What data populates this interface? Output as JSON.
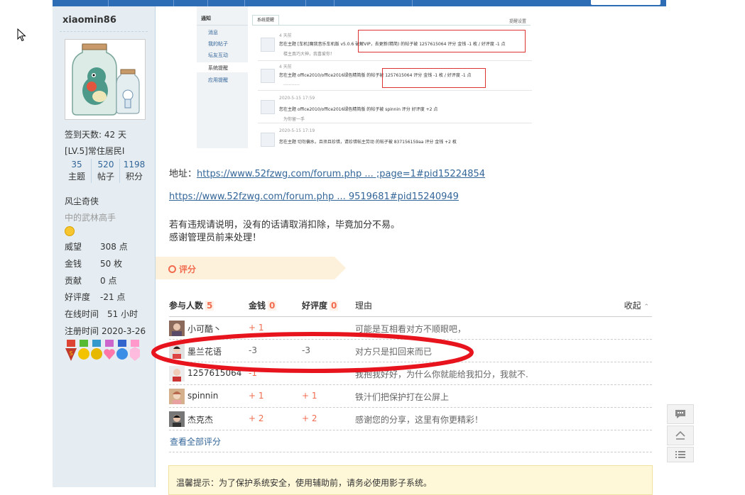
{
  "user": {
    "name": "xiaomin86",
    "checkin": "签到天数: 42 天",
    "level": "[LV.5]常住居民I",
    "stats": [
      {
        "num": "35",
        "label": "主题"
      },
      {
        "num": "520",
        "label": "帖子"
      },
      {
        "num": "1198",
        "label": "积分"
      }
    ],
    "title": "风尘奇侠",
    "rank": "中的武林高手",
    "props": [
      {
        "k": "威望",
        "v": "308 点"
      },
      {
        "k": "金钱",
        "v": "50 枚"
      },
      {
        "k": "贡献",
        "v": "0 点"
      },
      {
        "k": "好评度",
        "v": "-21 点"
      },
      {
        "k": "在线时间",
        "v": "51 小时"
      },
      {
        "k": "注册时间",
        "v": "2020-3-26"
      }
    ]
  },
  "embedded": {
    "sidebar_title": "通知",
    "sidebar_items": [
      "消息",
      "我的帖子",
      "坛友互动",
      "系统提醒",
      "应用提醒"
    ],
    "tab": "系统提醒",
    "settings": "提醒设置",
    "items": [
      {
        "time": "4 天前",
        "text": "您在主题 [车机]魔我音乐车机版 v5.0.6 破解VIP，去更新(精简) 的帖子被 1257615064 评分 金钱 -1 枚 / 好评度 -1 点",
        "quote": "楼主真巧大神，我喜爱你！"
      },
      {
        "time": "4 天前",
        "text": "您在主题 office2010/office2016绿色精简版 的帖子被 1257615064 评分 金钱 -1 枚 / 好评度 -1 点",
        "quote": "............"
      },
      {
        "time": "2020-5-15 17:59",
        "text": "您在主题 office2010/office2016绿色精简版 的帖子被 spinnin 评分 好评度 +2 点",
        "quote": "为你留一手"
      },
      {
        "time": "2020-5-15 17:19",
        "text": "您在主题 切勿偏水，且须且珍惜，请珍惜帖主劳动 的帖子被 837156159aa 评分 金钱 +2 枚",
        "quote": ""
      }
    ]
  },
  "post": {
    "addr_label": "地址：",
    "link1": "https://www.52fzwg.com/forum.php ... ;page=1#pid15224854",
    "link2": "https://www.52fzwg.com/forum.php ... 9519681#pid15240949",
    "line1": "若有违规请说明，没有的话请取消扣除，毕竟加分不易。",
    "line2": "感谢管理员前来处理！"
  },
  "rating": {
    "section_title": "评分",
    "col_participants": "参与人数",
    "participants_count": "5",
    "col_money": "金钱",
    "money_total": "0",
    "col_rep": "好评度",
    "rep_total": "0",
    "col_reason": "理由",
    "collapse": "收起",
    "rows": [
      {
        "name": "小可酷丶",
        "money": "+ 1",
        "rep": "",
        "reason": "可能是互相看对方不顺眼吧，"
      },
      {
        "name": "墨兰花语",
        "money": "-3",
        "rep": "-3",
        "reason": "对方只是扣回来而已"
      },
      {
        "name": "1257615064",
        "money": "-1",
        "rep": "",
        "reason": "我抱我好好，为什么你就能给我扣分，我就不."
      },
      {
        "name": "spinnin",
        "money": "+ 1",
        "rep": "+ 1",
        "reason": "铁汁们把保护打在公屏上"
      },
      {
        "name": "杰克杰",
        "money": "+ 2",
        "rep": "+ 2",
        "reason": "感谢您的分享，这里有你更精彩！"
      }
    ],
    "view_all": "查看全部评分"
  },
  "tip": "温馨提示：为了保护系统安全，使用辅助前，请务必使用影子系统。",
  "colors": {
    "accent": "#f26c4f",
    "link": "#336699",
    "sidebar": "#e5edf2",
    "nav": "#2d6db5",
    "highlight_oval": "#e8141d"
  }
}
